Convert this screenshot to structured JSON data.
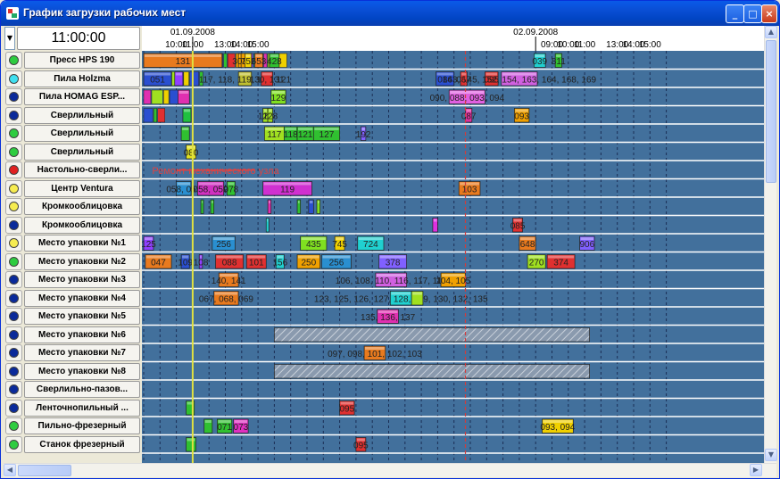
{
  "window": {
    "title": "График загрузки рабочих мест",
    "clock": "11:00:00",
    "controls": [
      "_",
      "□",
      "×"
    ]
  },
  "timeline": {
    "dates": [
      {
        "label": "01.09.2008",
        "h": 11
      },
      {
        "label": "02.09.2008",
        "h": 32
      }
    ],
    "ticks": [
      {
        "h": 10,
        "label": "10:00"
      },
      {
        "h": 11,
        "label": "11:00"
      },
      {
        "h": 13,
        "label": "13:00"
      },
      {
        "h": 14,
        "label": "14:00"
      },
      {
        "h": 15,
        "label": "15:00"
      },
      {
        "h": 33,
        "label": "09:00"
      },
      {
        "h": 34,
        "label": "10:00"
      },
      {
        "h": 35,
        "label": "11:00"
      },
      {
        "h": 37,
        "label": "13:00"
      },
      {
        "h": 38,
        "label": "14:00"
      },
      {
        "h": 39,
        "label": "15:00"
      }
    ],
    "current_hour": 11.0,
    "now_line_hour": 27.7
  },
  "colors": {
    "chart_bg": "#42709c",
    "row_line": "#ffffff",
    "now": "#d33b3b",
    "cursor": "#e0e040"
  },
  "workstations": [
    {
      "name": "Пресс HPS 190",
      "status": "green"
    },
    {
      "name": "Пила Holzma",
      "status": "cyan"
    },
    {
      "name": "Пила HOMAG ESP...",
      "status": "blue"
    },
    {
      "name": "Сверлильный",
      "status": "blue"
    },
    {
      "name": "Сверлильный",
      "status": "green"
    },
    {
      "name": "Сверлильный",
      "status": "green"
    },
    {
      "name": "Настольно-сверли...",
      "status": "red"
    },
    {
      "name": "Центр Ventura",
      "status": "yellow"
    },
    {
      "name": "Кромкооблицовка",
      "status": "yellow"
    },
    {
      "name": "Кромкооблицовка",
      "status": "blue"
    },
    {
      "name": "Место упаковки №1",
      "status": "yellow"
    },
    {
      "name": "Место упаковки №2",
      "status": "green"
    },
    {
      "name": "Место упаковки №3",
      "status": "blue"
    },
    {
      "name": "Место упаковки №4",
      "status": "blue"
    },
    {
      "name": "Место упаковки №5",
      "status": "blue"
    },
    {
      "name": "Место упаковки №6",
      "status": "blue"
    },
    {
      "name": "Место упаковки №7",
      "status": "blue"
    },
    {
      "name": "Место упаковки №8",
      "status": "blue"
    },
    {
      "name": "Сверлильно-пазов...",
      "status": "blue"
    },
    {
      "name": "Ленточнопильный ...",
      "status": "blue"
    },
    {
      "name": "Пильно-фрезерный",
      "status": "green"
    },
    {
      "name": "Станок фрезерный",
      "status": "green"
    }
  ],
  "bars": [
    [
      [
        8.0,
        12.8,
        "#e87a1e",
        "131"
      ],
      [
        13.8,
        13.9,
        "#f0a000",
        "303"
      ],
      [
        14.2,
        14.6,
        "#f0d000",
        "752"
      ],
      [
        14.8,
        15.3,
        "#e87a1e",
        "653"
      ],
      [
        15.7,
        16.3,
        "#30c030",
        "428"
      ],
      [
        31.9,
        32.6,
        "#20d0d0",
        "039"
      ],
      [
        33.2,
        33.6,
        "#30c030",
        "811"
      ]
    ],
    [
      [
        8.0,
        9.7,
        "#2a4fd0",
        "051"
      ],
      [
        9.9,
        10.4,
        "#9040ff",
        ""
      ],
      [
        13.8,
        14.6,
        "#c0c030",
        "117, 118, 119, 120, 121"
      ],
      [
        15.2,
        15.9,
        "#e03030",
        "130, 131"
      ],
      [
        25.9,
        27.0,
        "#2a4fd0",
        "086"
      ],
      [
        27.4,
        27.8,
        "#e03030",
        "087"
      ],
      [
        28.9,
        29.7,
        "#e03030",
        "095"
      ],
      [
        29.9,
        32.1,
        "#d060e0",
        "143, 145, 152, 154, 163, 164, 168, 169"
      ]
    ],
    [
      [
        10.1,
        10.8,
        "#e030b0",
        ""
      ],
      [
        15.8,
        16.7,
        "#80e020",
        "129"
      ],
      [
        26.7,
        28.9,
        "#e060e0",
        "090, 088, 093, 094"
      ]
    ],
    [
      [
        10.4,
        10.9,
        "#20c040",
        ""
      ],
      [
        15.3,
        15.6,
        "#a0e020",
        "120"
      ],
      [
        15.6,
        15.9,
        "#a0e020",
        "128"
      ],
      [
        27.7,
        28.1,
        "#e030a0",
        "087"
      ],
      [
        30.7,
        31.6,
        "#f0a000",
        "093"
      ]
    ],
    [
      [
        10.3,
        10.8,
        "#30c030",
        ""
      ],
      [
        15.4,
        16.6,
        "#a0e020",
        "117"
      ],
      [
        16.6,
        17.4,
        "#30c030",
        "118"
      ],
      [
        17.4,
        18.4,
        "#30c030",
        "121"
      ],
      [
        18.4,
        20.0,
        "#30c030",
        "127"
      ],
      [
        21.3,
        21.6,
        "#8060ff",
        "192"
      ]
    ],
    [
      [
        10.6,
        11.2,
        "#e0e020",
        "080"
      ]
    ],
    [
      [
        10.0,
        14.8,
        "#d44",
        "Ремонт механического узла"
      ]
    ],
    [
      [
        10.0,
        10.9,
        "#2a8fd0",
        "058, 059"
      ],
      [
        11.3,
        12.9,
        "#d030c0",
        "058, 059"
      ],
      [
        13.1,
        13.6,
        "#30c030",
        "078"
      ],
      [
        15.3,
        18.3,
        "#d030d0",
        "119"
      ],
      [
        27.3,
        28.6,
        "#e87a1e",
        "103"
      ]
    ],
    [
      [
        11.5,
        11.6,
        "#30c030",
        ""
      ],
      [
        12.1,
        12.3,
        "#30c030",
        ""
      ],
      [
        15.6,
        15.8,
        "#e030b0",
        ""
      ],
      [
        17.4,
        17.6,
        "#30c030",
        ""
      ],
      [
        18.1,
        18.4,
        "#2a4fd0",
        ""
      ],
      [
        18.6,
        18.8,
        "#80e020",
        ""
      ]
    ],
    [
      [
        15.5,
        15.6,
        "#20d0d0",
        ""
      ],
      [
        25.7,
        26.0,
        "#e030e0",
        ""
      ],
      [
        30.6,
        31.2,
        "#e03030",
        "085"
      ]
    ],
    [
      [
        8.0,
        8.6,
        "#9040ff",
        "125"
      ],
      [
        12.2,
        13.6,
        "#2a8fd0",
        "256"
      ],
      [
        17.6,
        19.2,
        "#80e020",
        "435"
      ],
      [
        19.7,
        20.3,
        "#f0d000",
        "745"
      ],
      [
        21.1,
        22.7,
        "#20d0d0",
        "724"
      ],
      [
        31.0,
        32.0,
        "#e87a1e",
        "648"
      ],
      [
        34.7,
        35.6,
        "#8060ff",
        "906"
      ]
    ],
    [
      [
        8.1,
        9.7,
        "#e87a1e",
        "047"
      ],
      [
        10.3,
        10.8,
        "#2a4fd0",
        "109"
      ],
      [
        11.4,
        11.6,
        "#9040ff",
        "108"
      ],
      [
        12.4,
        14.1,
        "#e03030",
        "088"
      ],
      [
        14.3,
        15.5,
        "#e03030",
        "101"
      ],
      [
        16.1,
        16.6,
        "#20d0d0",
        "156"
      ],
      [
        17.4,
        18.8,
        "#f0a000",
        "250"
      ],
      [
        18.9,
        20.7,
        "#2a8fd0",
        "256"
      ],
      [
        22.4,
        24.1,
        "#8060ff",
        "378"
      ],
      [
        31.5,
        32.6,
        "#a0e020",
        "270"
      ],
      [
        32.7,
        34.4,
        "#e03030",
        "374"
      ]
    ],
    [
      [
        12.6,
        13.8,
        "#e87a1e",
        "140, 141"
      ],
      [
        22.2,
        24.1,
        "#d060e0",
        "106, 108, 110, 116, 117, 118"
      ],
      [
        26.2,
        27.7,
        "#f0a000",
        "104, 105"
      ]
    ],
    [
      [
        12.3,
        13.8,
        "#e87a1e",
        "067, 068, 069"
      ],
      [
        23.1,
        24.4,
        "#20d0d0",
        "123, 125, 126, 127, 128, 129, 130, 132, 135"
      ],
      [
        24.4,
        25.1,
        "#a0e020",
        ""
      ]
    ],
    [
      [
        22.3,
        23.6,
        "#e030b0",
        "135, 136, 137"
      ]
    ],
    [
      [
        16.0,
        35.3,
        "#hatch",
        ""
      ]
    ],
    [
      [
        21.5,
        22.8,
        "#e87a1e",
        "097, 098, 101, 102, 103"
      ]
    ],
    [
      [
        16.0,
        35.3,
        "#hatch",
        ""
      ]
    ],
    [],
    [
      [
        10.6,
        11.1,
        "#30c030",
        ""
      ],
      [
        20.0,
        20.9,
        "#e03030",
        "095"
      ]
    ],
    [
      [
        11.7,
        12.2,
        "#30c030",
        ""
      ],
      [
        12.5,
        13.4,
        "#30c030",
        "071"
      ],
      [
        13.5,
        14.4,
        "#e030c0",
        "073"
      ],
      [
        32.4,
        34.3,
        "#f0d000",
        "093, 094"
      ]
    ],
    [
      [
        10.6,
        11.2,
        "#30c030",
        ""
      ],
      [
        21.0,
        21.6,
        "#e03030",
        "095"
      ]
    ]
  ],
  "filler_hours": [
    [
      8.0,
      16.1
    ],
    [
      8.0,
      11.5
    ],
    [
      8.0,
      10.2
    ],
    [
      8.0,
      8.9
    ]
  ]
}
